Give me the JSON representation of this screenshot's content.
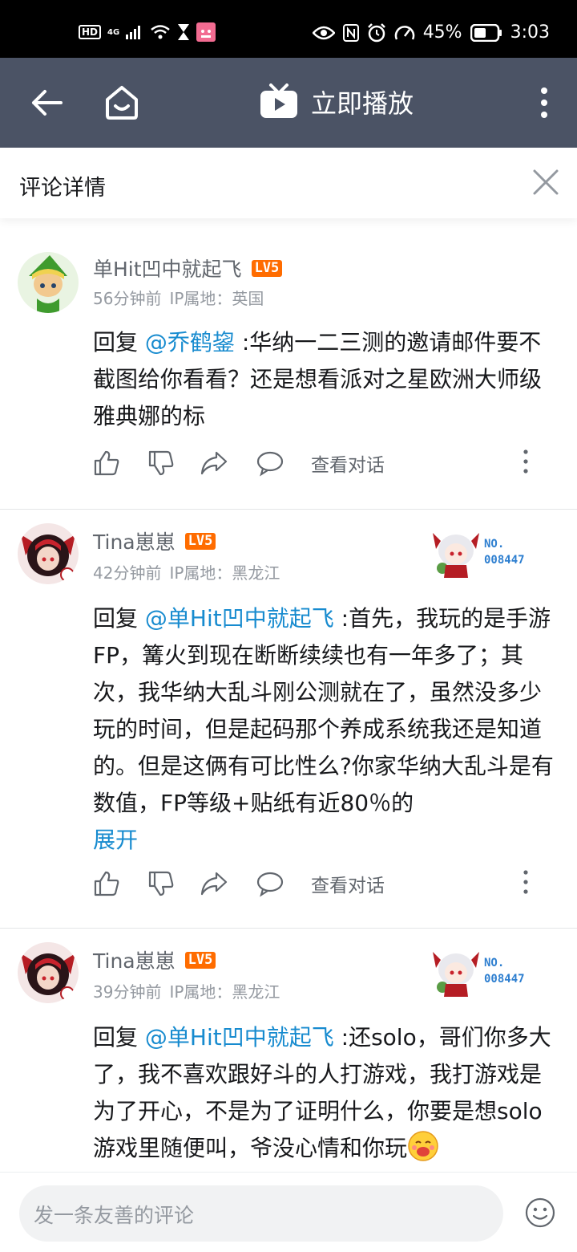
{
  "status_bar": {
    "hd": "HD",
    "network": "4G",
    "battery": "45%",
    "time": "3:03"
  },
  "top_bar": {
    "title": "立即播放"
  },
  "detail": {
    "title": "评论详情"
  },
  "comments": [
    {
      "username": "单Hit凹中就起飞",
      "level": "LV5",
      "time": "56分钟前",
      "ip": "IP属地：英国",
      "reply_prefix": "回复",
      "mention": "@乔鹤鋆",
      "text": ":华纳一二三测的邀请邮件要不截图给你看看？还是想看派对之星欧洲大师级雅典娜的标",
      "view_conversation": "查看对话"
    },
    {
      "username": "Tina崽崽",
      "level": "LV5",
      "time": "42分钟前",
      "ip": "IP属地：黑龙江",
      "badge_no": "NO.",
      "badge_num": "008447",
      "reply_prefix": "回复",
      "mention": "@单Hit凹中就起飞",
      "text": ":首先，我玩的是手游FP，篝火到现在断断续续也有一年多了；其次，我华纳大乱斗刚公测就在了，虽然没多少玩的时间，但是起码那个养成系统我还是知道的。但是这俩有可比性么?你家华纳大乱斗是有数值，FP等级+贴纸有近80％的",
      "expand": "展开",
      "view_conversation": "查看对话"
    },
    {
      "username": "Tina崽崽",
      "level": "LV5",
      "time": "39分钟前",
      "ip": "IP属地：黑龙江",
      "badge_no": "NO.",
      "badge_num": "008447",
      "reply_prefix": "回复",
      "mention": "@单Hit凹中就起飞",
      "text": ":还solo，哥们你多大了，我不喜欢跟好斗的人打游戏，我打游戏是为了开心，不是为了证明什么，你要是想solo游戏里随便叫，爷没心情和你玩"
    }
  ],
  "input": {
    "placeholder": "发一条友善的评论"
  },
  "colors": {
    "top_bar": "#4b5365",
    "link": "#178bcf",
    "level_badge": "#ff6c00"
  },
  "icons": [
    "back-arrow-icon",
    "home-icon",
    "tv-play-icon",
    "more-vertical-icon",
    "close-icon",
    "like-icon",
    "dislike-icon",
    "share-icon",
    "reply-icon",
    "emoji-icon"
  ]
}
